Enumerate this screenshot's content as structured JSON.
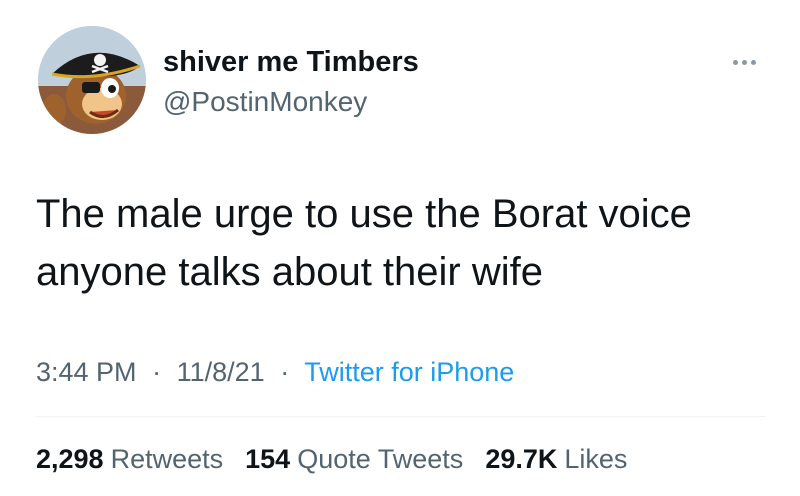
{
  "author": {
    "display_name": "shiver me Timbers",
    "handle": "@PostinMonkey",
    "avatar_icon": "pirate-monkey-avatar"
  },
  "tweet": {
    "text": "The male urge to use the Borat voice anyone talks about their wife",
    "time": "3:44 PM",
    "date": "11/8/21",
    "separator": "·",
    "source": "Twitter for iPhone"
  },
  "stats": {
    "retweets_count": "2,298",
    "retweets_label": "Retweets",
    "quote_tweets_count": "154",
    "quote_tweets_label": "Quote Tweets",
    "likes_count": "29.7K",
    "likes_label": "Likes"
  },
  "colors": {
    "text_primary": "#0f1419",
    "text_secondary": "#536471",
    "link": "#1d9bf0",
    "divider": "#eff3f4"
  }
}
